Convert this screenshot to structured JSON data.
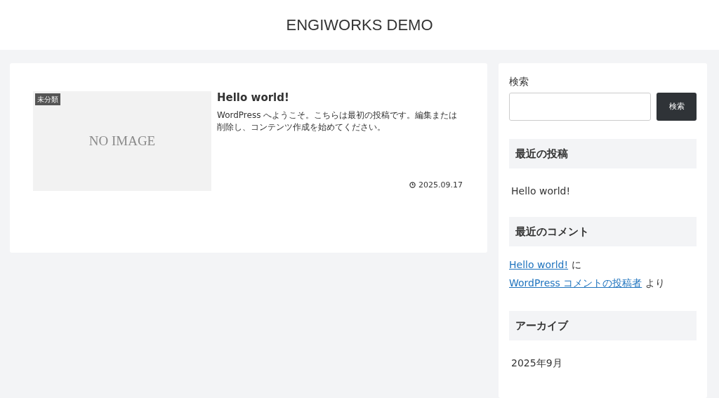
{
  "site_title": "ENGIWORKS DEMO",
  "post": {
    "category": "未分類",
    "thumbnail_text": "NO IMAGE",
    "title": "Hello world!",
    "excerpt": "WordPress へようこそ。こちらは最初の投稿です。編集または削除し、コンテンツ作成を始めてください。",
    "date": "2025.09.17"
  },
  "sidebar": {
    "search": {
      "label": "検索",
      "button": "検索"
    },
    "widgets": [
      {
        "kind": "list",
        "title": "最近の投稿",
        "items": [
          "Hello world!"
        ]
      },
      {
        "kind": "comments",
        "title": "最近のコメント",
        "parts": [
          {
            "kind": "link",
            "text": "Hello world!"
          },
          {
            "kind": "text",
            "text": "に"
          },
          {
            "kind": "link",
            "text": "WordPress コメントの投稿者"
          },
          {
            "kind": "text",
            "text": "より"
          }
        ]
      },
      {
        "kind": "list",
        "title": "アーカイブ",
        "items": [
          "2025年9月"
        ]
      }
    ]
  }
}
